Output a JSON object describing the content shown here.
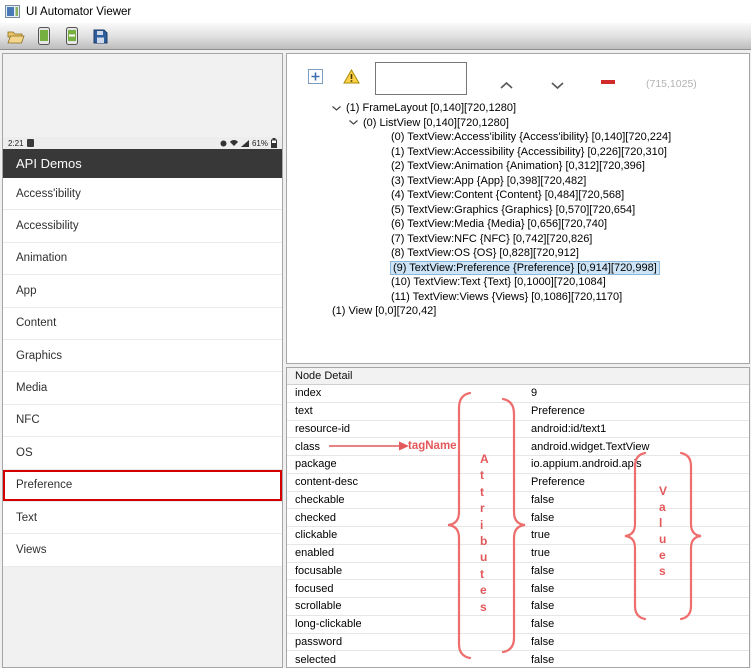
{
  "window": {
    "title": "UI Automator Viewer"
  },
  "toolbar": {
    "icons": [
      "open-folder-icon",
      "device-screenshot-icon",
      "device-screenshot-compressed-icon",
      "save-icon"
    ]
  },
  "device": {
    "status": {
      "time": "2:21",
      "battery_percent": "61%"
    },
    "app_title": "API Demos",
    "menu_items": [
      "Access'ibility",
      "Accessibility",
      "Animation",
      "App",
      "Content",
      "Graphics",
      "Media",
      "NFC",
      "OS",
      "Preference",
      "Text",
      "Views"
    ],
    "highlighted_item": "Preference"
  },
  "tree_panel": {
    "coordinates": "(715,1025)",
    "nodes": [
      "(1) FrameLayout [0,140][720,1280]",
      "(0) ListView [0,140][720,1280]",
      "(0) TextView:Access'ibility {Access'ibility} [0,140][720,224]",
      "(1) TextView:Accessibility {Accessibility} [0,226][720,310]",
      "(2) TextView:Animation {Animation} [0,312][720,396]",
      "(3) TextView:App {App} [0,398][720,482]",
      "(4) TextView:Content {Content} [0,484][720,568]",
      "(5) TextView:Graphics {Graphics} [0,570][720,654]",
      "(6) TextView:Media {Media} [0,656][720,740]",
      "(7) TextView:NFC {NFC} [0,742][720,826]",
      "(8) TextView:OS {OS} [0,828][720,912]",
      "(9) TextView:Preference {Preference} [0,914][720,998]",
      "(10) TextView:Text {Text} [0,1000][720,1084]",
      "(11) TextView:Views {Views} [0,1086][720,1170]",
      "(1) View [0,0][720,42]"
    ],
    "selected_node": "(9) TextView:Preference {Preference} [0,914][720,998]"
  },
  "node_detail": {
    "title": "Node Detail",
    "rows": [
      {
        "attr": "index",
        "value": "9"
      },
      {
        "attr": "text",
        "value": "Preference"
      },
      {
        "attr": "resource-id",
        "value": "android:id/text1"
      },
      {
        "attr": "class",
        "value": "android.widget.TextView"
      },
      {
        "attr": "package",
        "value": "io.appium.android.apis"
      },
      {
        "attr": "content-desc",
        "value": "Preference"
      },
      {
        "attr": "checkable",
        "value": "false"
      },
      {
        "attr": "checked",
        "value": "false"
      },
      {
        "attr": "clickable",
        "value": "true"
      },
      {
        "attr": "enabled",
        "value": "true"
      },
      {
        "attr": "focusable",
        "value": "false"
      },
      {
        "attr": "focused",
        "value": "false"
      },
      {
        "attr": "scrollable",
        "value": "false"
      },
      {
        "attr": "long-clickable",
        "value": "false"
      },
      {
        "attr": "password",
        "value": "false"
      },
      {
        "attr": "selected",
        "value": "false"
      }
    ]
  },
  "annotations": {
    "tag_name_label": "tagName",
    "attributes_label": "Attributes",
    "values_label": "Values",
    "annotation_color": "#e3585a",
    "highlight_red": "#d40000",
    "selection_blue": "#cde4f6"
  }
}
